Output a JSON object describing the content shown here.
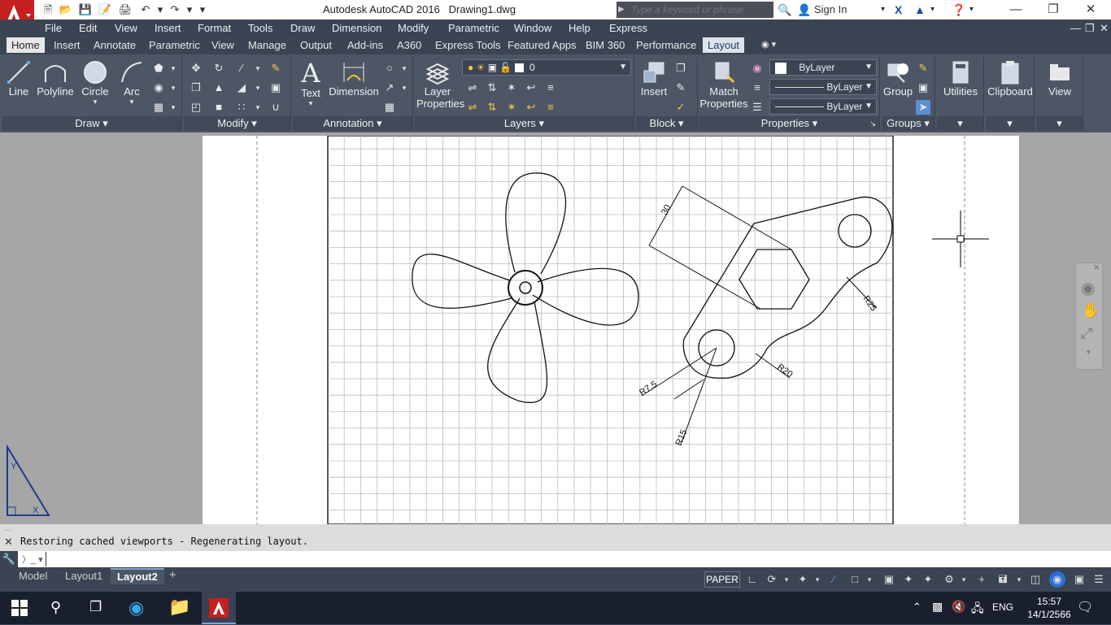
{
  "title_bar": {
    "app_title": "Autodesk AutoCAD 2016",
    "file_name": "Drawing1.dwg",
    "search_placeholder": "Type a keyword or phrase",
    "sign_in": "Sign In"
  },
  "menu": [
    "File",
    "Edit",
    "View",
    "Insert",
    "Format",
    "Tools",
    "Draw",
    "Dimension",
    "Modify",
    "Parametric",
    "Window",
    "Help",
    "Express"
  ],
  "ribbon_tabs": [
    "Home",
    "Insert",
    "Annotate",
    "Parametric",
    "View",
    "Manage",
    "Output",
    "Add-ins",
    "A360",
    "Express Tools",
    "Featured Apps",
    "BIM 360",
    "Performance",
    "Layout"
  ],
  "ribbon": {
    "draw": {
      "label": "Draw",
      "line": "Line",
      "polyline": "Polyline",
      "circle": "Circle",
      "arc": "Arc"
    },
    "modify": {
      "label": "Modify"
    },
    "annotation": {
      "label": "Annotation",
      "text": "Text",
      "dimension": "Dimension"
    },
    "layers": {
      "label": "Layers",
      "layer_properties": "Layer Properties",
      "current_layer": "0"
    },
    "block": {
      "label": "Block",
      "insert": "Insert"
    },
    "properties": {
      "label": "Properties",
      "match": "Match Properties",
      "color": "ByLayer",
      "linetype": "ByLayer",
      "lineweight": "ByLayer"
    },
    "groups": {
      "label": "Groups",
      "group": "Group"
    },
    "utilities": {
      "label": "Utilities"
    },
    "clipboard": {
      "label": "Clipboard"
    },
    "view": {
      "label": "View"
    }
  },
  "dimensions": {
    "d30": "30",
    "r25": "R25",
    "r20": "R20",
    "r75": "R7.5",
    "r15": "R15"
  },
  "command": {
    "history": "Restoring cached viewports - Regenerating layout.",
    "input": ""
  },
  "layout_tabs": [
    "Model",
    "Layout1",
    "Layout2"
  ],
  "active_layout": "Layout2",
  "status": {
    "space": "PAPER"
  },
  "taskbar": {
    "lang": "ENG",
    "time": "15:57",
    "date": "14/1/2566"
  },
  "colors": {
    "accent": "#3b4453",
    "ribbon": "#4d5665",
    "paper": "#ffffff",
    "background": "#a6a6a6"
  }
}
